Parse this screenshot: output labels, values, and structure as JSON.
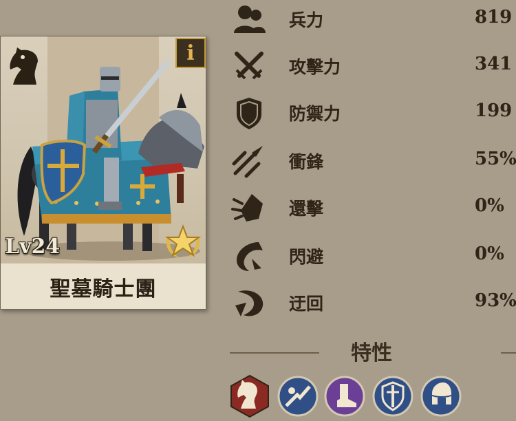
{
  "unit": {
    "name": "聖墓騎士團",
    "level": "Lv24",
    "info_label": "i",
    "class_icon": "knight-chess-icon",
    "rank_icon": "gold-star-laurel-icon"
  },
  "stats": [
    {
      "icon": "troops-icon",
      "label": "兵力",
      "value": "819"
    },
    {
      "icon": "attack-crossed-swords-icon",
      "label": "攻擊力",
      "value": "341"
    },
    {
      "icon": "defense-shield-icon",
      "label": "防禦力",
      "value": "199"
    },
    {
      "icon": "charge-spear-icon",
      "label": "衝鋒",
      "value": "55%"
    },
    {
      "icon": "counter-icon",
      "label": "還擊",
      "value": "0%"
    },
    {
      "icon": "dodge-icon",
      "label": "閃避",
      "value": "0%"
    },
    {
      "icon": "flank-icon",
      "label": "迂回",
      "value": "93%"
    }
  ],
  "traits": {
    "title": "特性",
    "badges": [
      "cavalry-trait-icon",
      "charge-trait-icon",
      "boot-trait-icon",
      "shield-sword-trait-icon",
      "helmet-trait-icon"
    ]
  },
  "colors": {
    "background": "#a89c8a",
    "text": "#2e2418",
    "accent_gold": "#c59a3b",
    "trait_red": "#8a2a22",
    "trait_blue": "#2f4f86",
    "trait_purple": "#6a3f95"
  }
}
